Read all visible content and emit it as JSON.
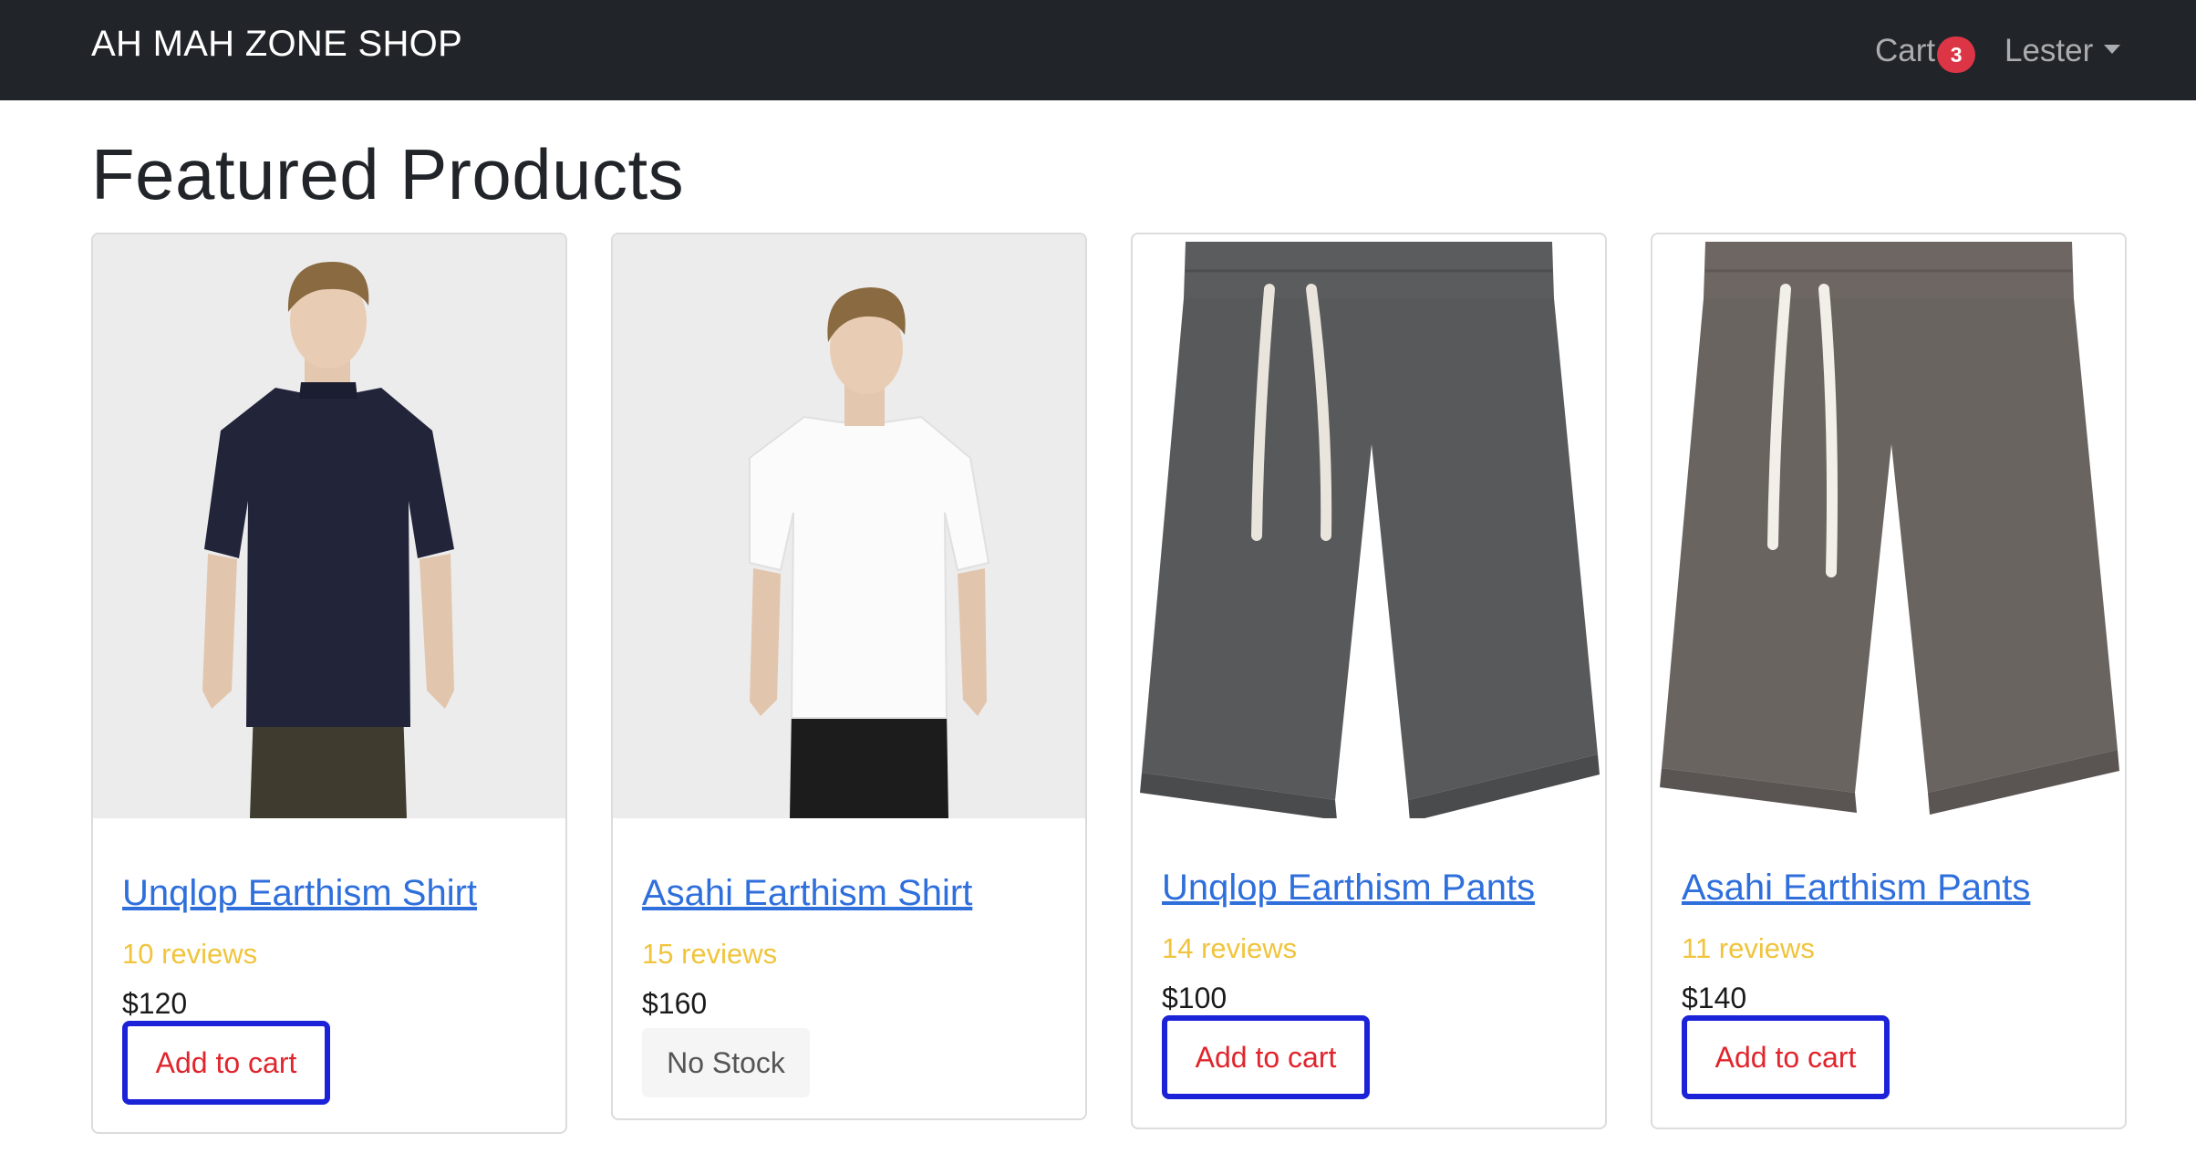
{
  "navbar": {
    "brand": "AH MAH ZONE SHOP",
    "cart_label": "Cart",
    "cart_count": "3",
    "user_name": "Lester"
  },
  "page": {
    "title": "Featured Products"
  },
  "products": [
    {
      "title": "Unqlop Earthism Shirt",
      "reviews": "10 reviews",
      "price": "$120",
      "action": "Add to cart",
      "image_icon": "navy-tshirt-model-photo"
    },
    {
      "title": "Asahi Earthism Shirt",
      "reviews": "15 reviews",
      "price": "$160",
      "action": "No Stock",
      "image_icon": "white-tshirt-model-photo"
    },
    {
      "title": "Unqlop Earthism Pants",
      "reviews": "14 reviews",
      "price": "$100",
      "action": "Add to cart",
      "image_icon": "dark-grey-shorts-photo"
    },
    {
      "title": "Asahi Earthism Pants",
      "reviews": "11 reviews",
      "price": "$140",
      "action": "Add to cart",
      "image_icon": "brown-grey-shorts-photo"
    }
  ],
  "colors": {
    "navbar_bg": "#212529",
    "link": "#2f6fdc",
    "reviews": "#f0c43c",
    "button_text": "#e0252c",
    "button_border": "#1b22d8",
    "badge": "#dc3545"
  }
}
